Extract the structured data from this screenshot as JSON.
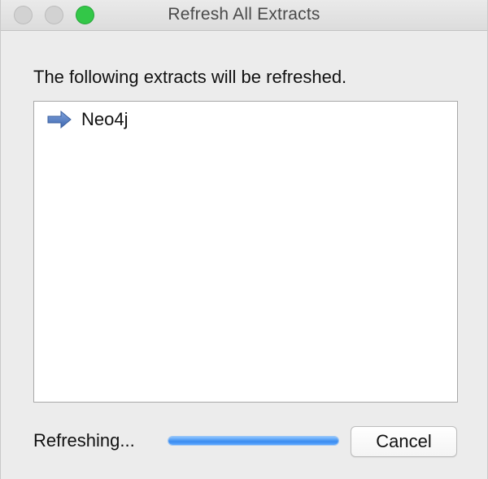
{
  "window": {
    "title": "Refresh All Extracts"
  },
  "dialog": {
    "heading": "The following extracts will be refreshed.",
    "extracts": [
      {
        "label": "Neo4j",
        "icon": "arrow-right-icon",
        "icon_color": "#4f78bf"
      }
    ],
    "status": "Refreshing...",
    "progress": 1.0,
    "cancel_label": "Cancel"
  },
  "colors": {
    "zoom": "#33c748",
    "inactive_button": "#d2d2d2",
    "progress_blue": "#3a8cf0"
  }
}
